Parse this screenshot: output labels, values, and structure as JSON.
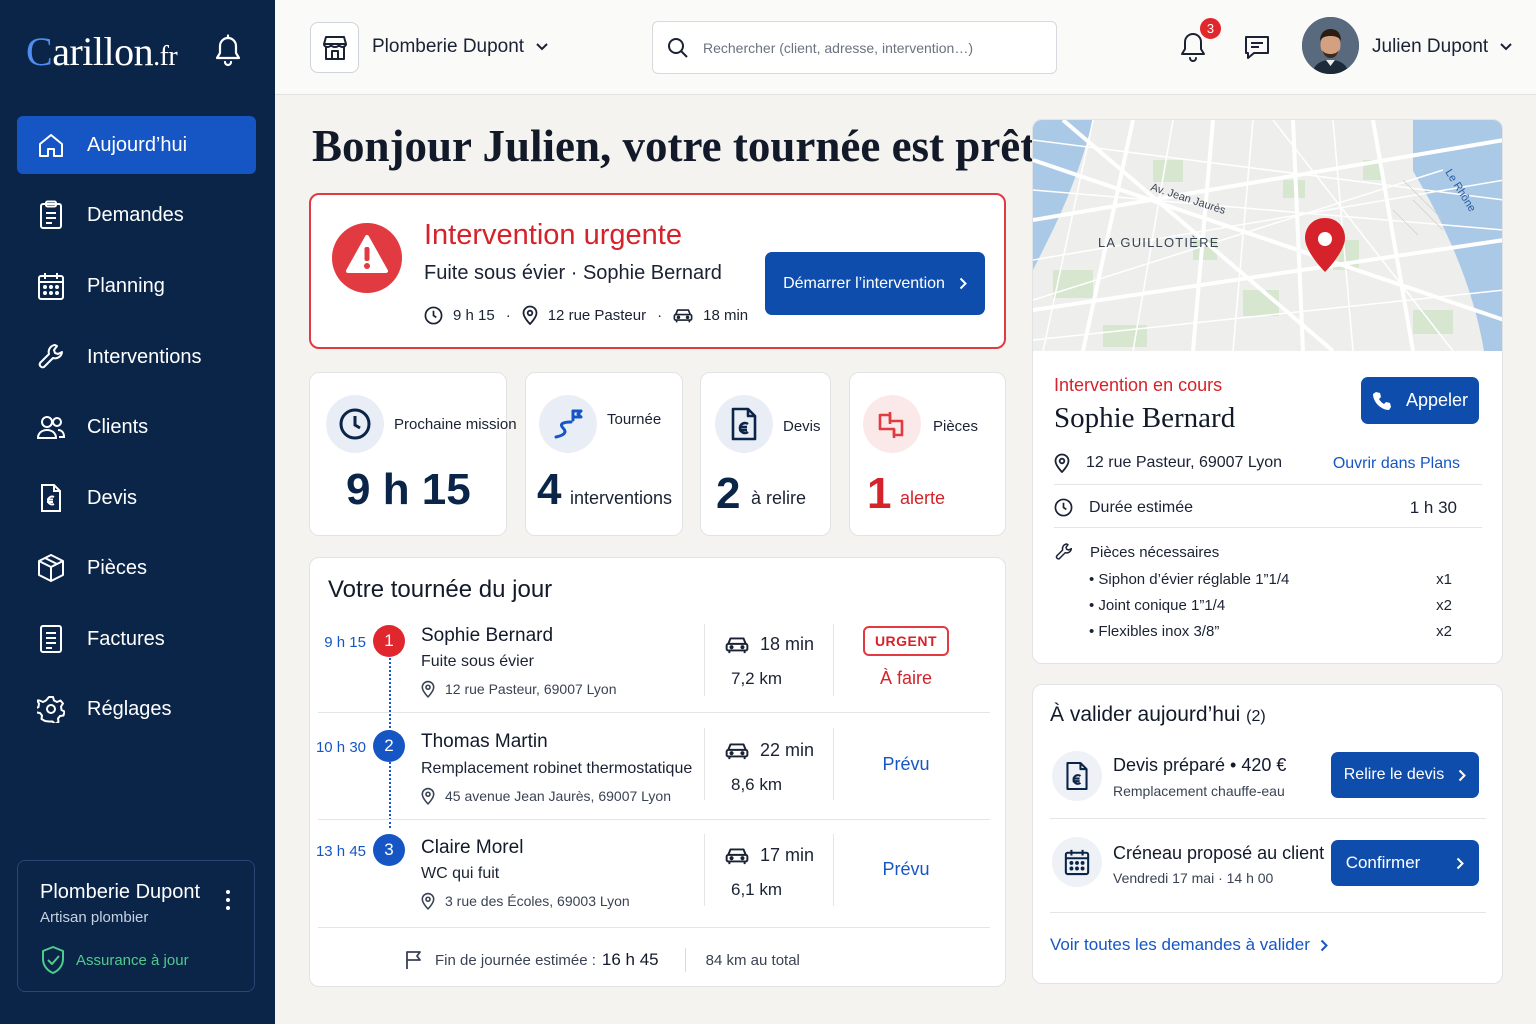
{
  "sidebar": {
    "logo_main": "Carillon",
    "logo_suffix": ".fr",
    "nav": [
      {
        "label": "Aujourd’hui",
        "icon": "home-icon",
        "active": true
      },
      {
        "label": "Demandes",
        "icon": "clipboard-icon"
      },
      {
        "label": "Planning",
        "icon": "calendar-icon"
      },
      {
        "label": "Interventions",
        "icon": "wrench-icon"
      },
      {
        "label": "Clients",
        "icon": "users-icon"
      },
      {
        "label": "Devis",
        "icon": "euro-document-icon"
      },
      {
        "label": "Pièces",
        "icon": "box-icon"
      },
      {
        "label": "Factures",
        "icon": "invoice-icon"
      },
      {
        "label": "Réglages",
        "icon": "gear-icon"
      }
    ],
    "company": {
      "name": "Plomberie Dupont",
      "role": "Artisan plombier",
      "insurance": "Assurance à jour"
    }
  },
  "topbar": {
    "shop_name": "Plomberie Dupont",
    "search_placeholder": "Rechercher (client, adresse, intervention…)",
    "notifications_count": "3",
    "user_name": "Julien Dupont"
  },
  "greeting": "Bonjour Julien, votre tournée est prête.",
  "urgent": {
    "title": "Intervention urgente",
    "subtitle": "Fuite sous évier · Sophie Bernard",
    "time": "9 h 15",
    "address": "12 rue Pasteur",
    "travel": "18 min",
    "button": "Démarrer l’intervention"
  },
  "stats": [
    {
      "label": "Prochaine mission",
      "value": "9 h 15",
      "unit": ""
    },
    {
      "label": "Tournée",
      "value": "4",
      "unit": "interventions"
    },
    {
      "label": "Devis",
      "value": "2",
      "unit": "à relire"
    },
    {
      "label": "Pièces",
      "value": "1",
      "unit": "alerte"
    }
  ],
  "tour": {
    "title": "Votre tournée du jour",
    "rows": [
      {
        "time": "9 h 15",
        "num": "1",
        "name": "Sophie Bernard",
        "desc": "Fuite sous évier",
        "address": "12 rue Pasteur, 69007 Lyon",
        "duration": "18 min",
        "distance": "7,2 km",
        "badge": "URGENT",
        "status": "À faire"
      },
      {
        "time": "10 h 30",
        "num": "2",
        "name": "Thomas Martin",
        "desc": "Remplacement robinet thermostatique",
        "address": "45 avenue Jean Jaurès, 69007 Lyon",
        "duration": "22 min",
        "distance": "8,6 km",
        "status": "Prévu"
      },
      {
        "time": "13 h 45",
        "num": "3",
        "name": "Claire Morel",
        "desc": "WC qui fuit",
        "address": "3 rue des Écoles, 69003 Lyon",
        "duration": "17 min",
        "distance": "6,1 km",
        "status": "Prévu"
      }
    ],
    "footer_label": "Fin de journée estimée :",
    "footer_time": "16 h 45",
    "footer_total": "84 km au total"
  },
  "map": {
    "street_label": "Av. Jean Jaurès",
    "district_label": "LA GUILLOTIÈRE",
    "river_label": "Le Rhône"
  },
  "current": {
    "label": "Intervention en cours",
    "name": "Sophie Bernard",
    "call_button": "Appeler",
    "address": "12 rue Pasteur, 69007 Lyon",
    "open_maps": "Ouvrir dans Plans",
    "duration_label": "Durée estimée",
    "duration_value": "1 h 30",
    "parts_label": "Pièces nécessaires",
    "parts": [
      {
        "name": "Siphon d’évier réglable 1”1/4",
        "qty": "x1"
      },
      {
        "name": "Joint conique 1”1/4",
        "qty": "x2"
      },
      {
        "name": "Flexibles inox 3/8”",
        "qty": "x2"
      }
    ]
  },
  "validate": {
    "title": "À valider aujourd’hui",
    "count": "(2)",
    "items": [
      {
        "title": "Devis préparé • 420 €",
        "sub": "Remplacement chauffe-eau",
        "button": "Relire le devis"
      },
      {
        "title": "Créneau proposé au client",
        "sub": "Vendredi 17 mai · 14 h 00",
        "button": "Confirmer"
      }
    ],
    "link": "Voir toutes les demandes à valider"
  },
  "colors": {
    "sidebar": "#0b2548",
    "accent": "#1656c4",
    "urgent": "#e13a40",
    "insurance": "#4fcb8c"
  }
}
